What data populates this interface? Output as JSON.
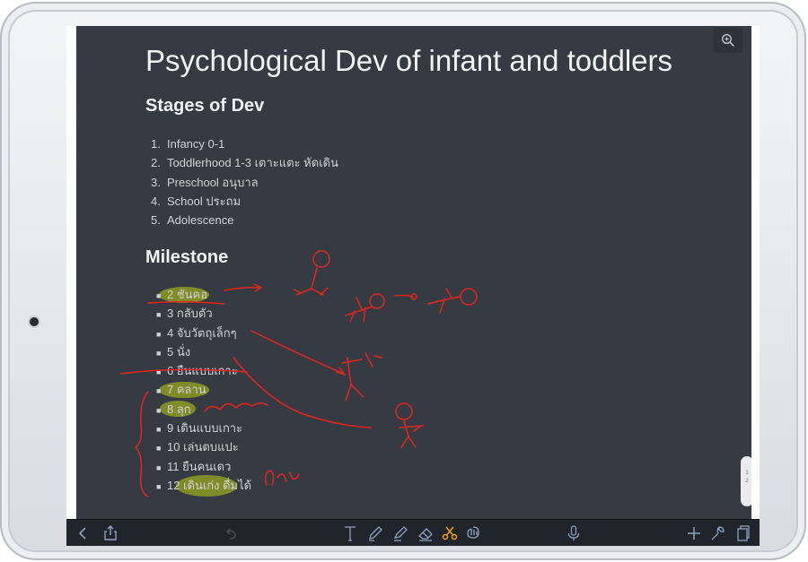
{
  "document": {
    "title": "Psychological Dev of infant and toddlers",
    "stages_heading": "Stages of Dev",
    "stages": [
      {
        "num": "1.",
        "text": "Infancy 0-1"
      },
      {
        "num": "2.",
        "text": "Toddlerhood 1-3 เตาะแตะ หัดเดิน"
      },
      {
        "num": "3.",
        "text": "Preschool อนุบาล"
      },
      {
        "num": "4.",
        "text": "School ประถม"
      },
      {
        "num": "5.",
        "text": "Adolescence"
      }
    ],
    "milestone_heading": "Milestone",
    "milestones": [
      "2 ชันคอ",
      "3 กลับตัว",
      "4 จับวัตถุเล็กๆ",
      "5 นั่ง",
      "6 ยืนแบบเกาะ",
      "7 คลาน",
      "8 ลุก",
      "9 เดินแบบเกาะ",
      "10 เล่นตบแปะ",
      "11 ยืนคนเดว",
      "12 เดินเก่ง ดื่มได้"
    ]
  },
  "pager": {
    "top": "1",
    "bottom": "2"
  },
  "colors": {
    "page_bg": "#363b43",
    "ink_red": "#e2261c",
    "highlight": "#8d9b22",
    "toolbar_bg": "#20242b",
    "accent_active": "#f2a200"
  },
  "toolbar": {
    "icons": [
      "back-icon",
      "share-icon",
      "undo-icon",
      "text-tool-icon",
      "pen-icon",
      "highlighter-icon",
      "eraser-icon",
      "scissors-icon",
      "lasso-hand-icon",
      "microphone-icon",
      "add-icon",
      "wrench-icon",
      "pages-icon"
    ],
    "active": "scissors-icon"
  }
}
